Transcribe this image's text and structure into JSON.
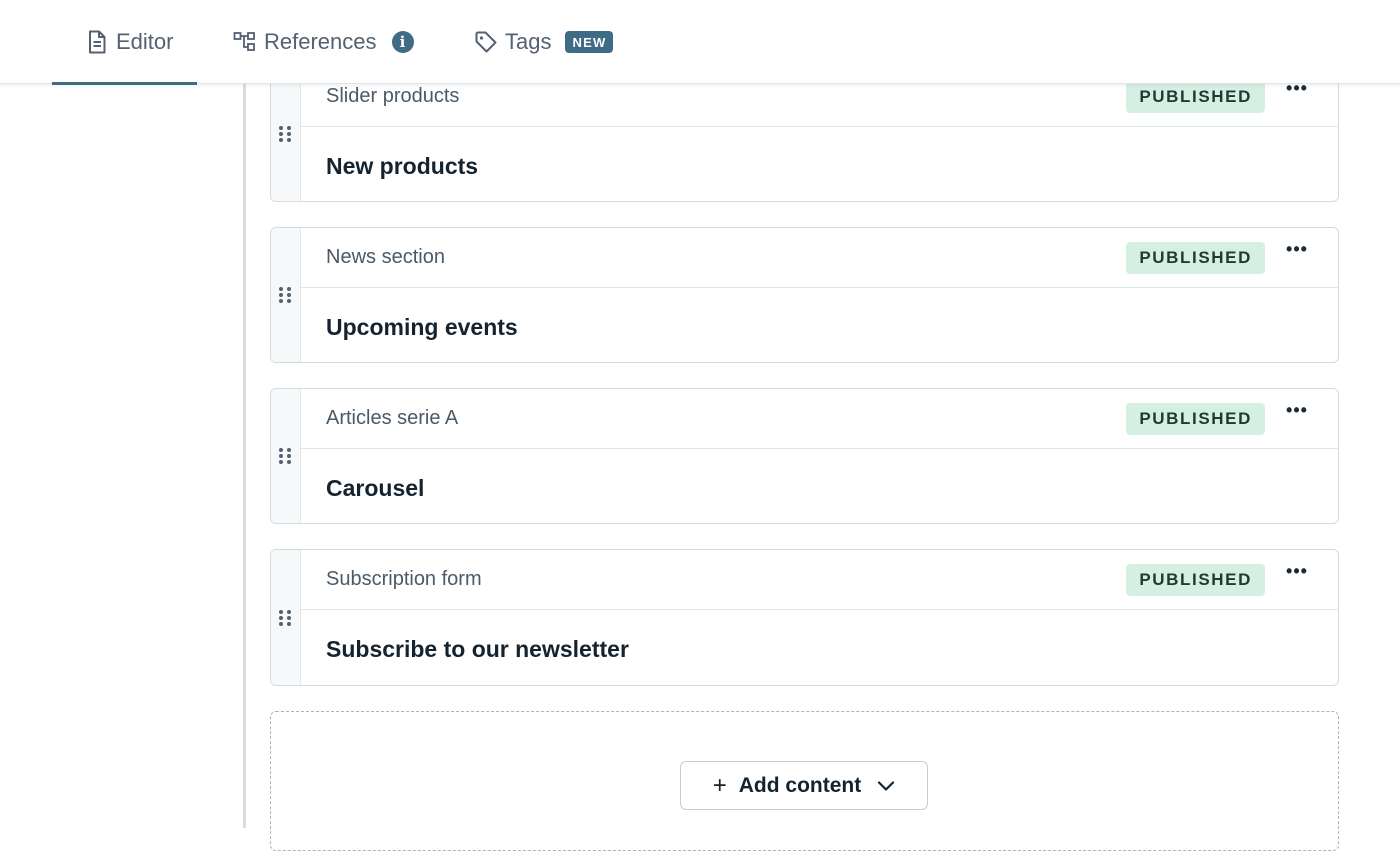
{
  "tabs": {
    "editor": {
      "label": "Editor",
      "icon": "document-icon"
    },
    "references": {
      "label": "References",
      "icon": "hierarchy-icon",
      "info_badge": "i"
    },
    "tags": {
      "label": "Tags",
      "icon": "tag-icon",
      "badge": "NEW"
    }
  },
  "cards": [
    {
      "type": "Slider products",
      "status": "PUBLISHED",
      "title": "New products"
    },
    {
      "type": "News section",
      "status": "PUBLISHED",
      "title": "Upcoming events"
    },
    {
      "type": "Articles serie A",
      "status": "PUBLISHED",
      "title": "Carousel"
    },
    {
      "type": "Subscription form",
      "status": "PUBLISHED",
      "title": "Subscribe to our newsletter"
    }
  ],
  "add_content": {
    "label": "Add content"
  },
  "colors": {
    "accent": "#3f6b85",
    "status_bg": "#d5f0e3",
    "border": "#d3dbe0"
  }
}
